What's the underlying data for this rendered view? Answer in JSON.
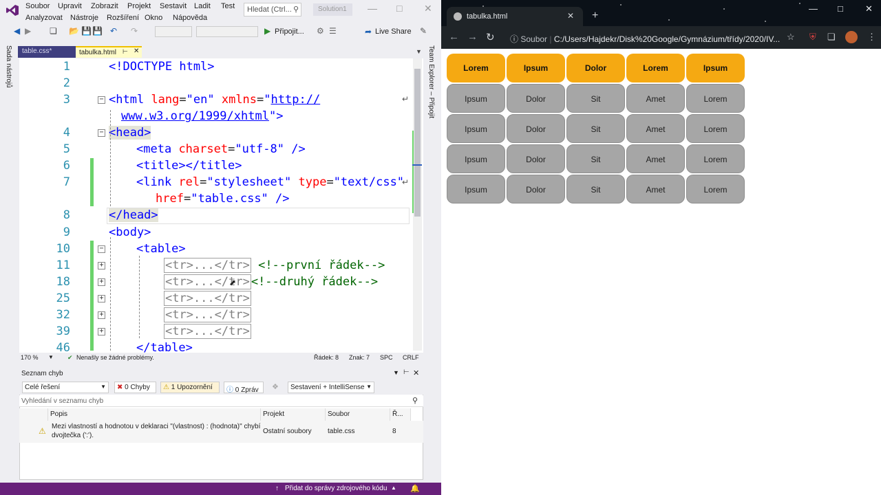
{
  "vs": {
    "menu_row1": [
      "Soubor",
      "Upravit",
      "Zobrazit",
      "Projekt",
      "Sestavit",
      "Ladit",
      "Test"
    ],
    "menu_row2": [
      "Analyzovat",
      "Nástroje",
      "Rozšíření",
      "Okno",
      "Nápověda"
    ],
    "search_placeholder": "Hledat (Ctrl...",
    "solution_label": "Solution1",
    "attach_label": "Připojit...",
    "live_share": "Live Share",
    "left_strip_label": "Sada nástrojů",
    "right_strip_label": "Team Explorer – Připojit",
    "tabs": [
      {
        "label": "table.css*"
      },
      {
        "label": "tabulka.html"
      }
    ],
    "code_lines": [
      {
        "ln": "1"
      },
      {
        "ln": ""
      },
      {
        "ln": "2"
      },
      {
        "ln": "3"
      },
      {
        "ln": ""
      },
      {
        "ln": "4"
      },
      {
        "ln": "5"
      },
      {
        "ln": "6"
      },
      {
        "ln": "7"
      },
      {
        "ln": ""
      },
      {
        "ln": "8"
      },
      {
        "ln": "9"
      },
      {
        "ln": "10"
      },
      {
        "ln": "11"
      },
      {
        "ln": "18"
      },
      {
        "ln": "25"
      },
      {
        "ln": "32"
      },
      {
        "ln": "39"
      },
      {
        "ln": "46"
      }
    ],
    "code_text": {
      "doctype": "<!DOCTYPE html>",
      "html_open": "<html",
      "lang_attr": "lang",
      "lang_val": "\"en\"",
      "xmlns_attr": "xmlns",
      "xmlns_val_1": "http://",
      "xmlns_val_2": "www.w3.org/1999/xhtml",
      "head_open": "<head>",
      "meta": "<meta",
      "charset_attr": "charset",
      "charset_val": "\"utf-8\"",
      "title_pair": "<title></title>",
      "link": "<link",
      "rel_attr": "rel",
      "rel_val": "\"stylesheet\"",
      "type_attr": "type",
      "type_val": "\"text/css\"",
      "href_attr": "href",
      "href_val": "\"table.css\"",
      "head_close": "</head>",
      "body_open": "<body>",
      "table_open": "<table>",
      "tr_collapsed": "<tr>...</tr>",
      "comment_1": "<!--první řádek-->",
      "comment_2": "<!--druhý řádek-->",
      "table_close": "</table>"
    },
    "status": {
      "zoom": "170 %",
      "issues": "Nenašly se žádné problémy.",
      "line": "Řádek: 8",
      "char": "Znak: 7",
      "spc": "SPC",
      "crlf": "CRLF"
    },
    "error_list": {
      "title": "Seznam chyb",
      "scope": "Celé řešení",
      "errors": "0 Chyby",
      "warnings": "1 Upozornění",
      "messages": "0 Zpráv",
      "build": "Sestavení + IntelliSense",
      "search_placeholder": "Vyhledání v seznamu chyb",
      "columns": [
        "Popis",
        "Projekt",
        "Soubor",
        "Ř..."
      ],
      "rows": [
        {
          "desc_1": "Mezi vlastností a hodnotou v deklaraci \"(vlastnost) : (hodnota)\" chybí",
          "desc_2": "dvojtečka (':').",
          "project": "Ostatní soubory",
          "file": "table.css",
          "line": "8"
        }
      ]
    },
    "bottom_status": "Přidat do správy zdrojového kódu",
    "accent_color": "#68217a"
  },
  "browser": {
    "tab_title": "tabulka.html",
    "address_label": "Soubor",
    "address": "C:/Users/Hajdekr/Disk%20Google/Gymnázium/třídy/2020/IV...",
    "table": {
      "header": [
        "Lorem",
        "Ipsum",
        "Dolor",
        "Lorem",
        "Ipsum"
      ],
      "rows": [
        [
          "Ipsum",
          "Dolor",
          "Sit",
          "Amet",
          "Lorem"
        ],
        [
          "Ipsum",
          "Dolor",
          "Sit",
          "Amet",
          "Lorem"
        ],
        [
          "Ipsum",
          "Dolor",
          "Sit",
          "Amet",
          "Lorem"
        ],
        [
          "Ipsum",
          "Dolor",
          "Sit",
          "Amet",
          "Lorem"
        ]
      ],
      "header_color": "#f5a912",
      "body_color": "#a6a6a6"
    }
  }
}
